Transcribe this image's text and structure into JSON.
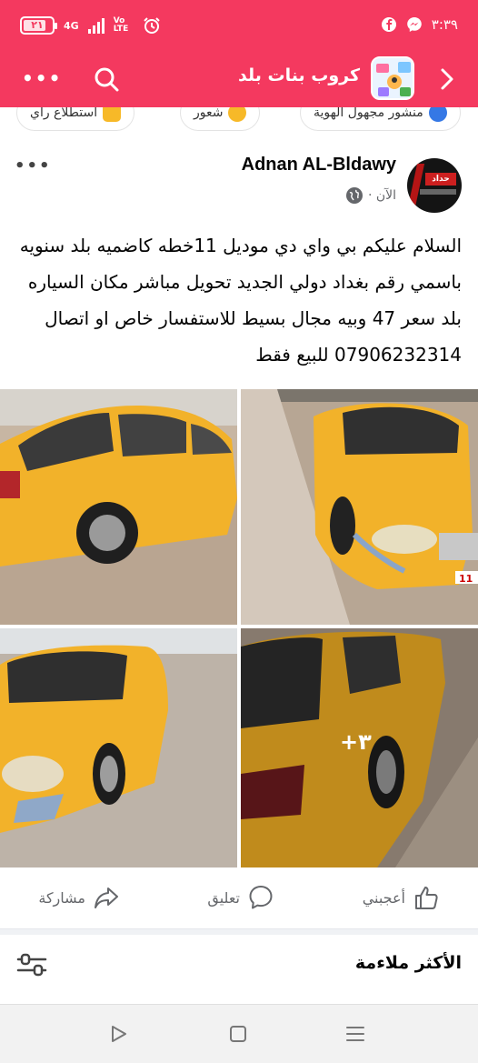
{
  "status_bar": {
    "battery": "٢١",
    "network": "4G",
    "volte": "Vo LTE",
    "time": "٣:٣٩",
    "bg_color": "#f4395f"
  },
  "app_bar": {
    "title": "كروب بنات بلد",
    "icons": [
      "back-chevron-icon",
      "search-icon",
      "more-icon"
    ]
  },
  "chips": [
    {
      "label": "منشور مجهول الهوية",
      "icon": "anonymous-icon"
    },
    {
      "label": "شعور",
      "icon": "feeling-icon"
    },
    {
      "label": "استطلاع رأي",
      "icon": "poll-icon"
    }
  ],
  "post": {
    "author": "Adnan AL-Bldawy",
    "time": "الآن ·",
    "privacy_icon": "globe-icon",
    "avatar_text": "حداد",
    "text": "السلام عليكم بي واي دي موديل 11خطه كاضميه بلد سنويه باسمي رقم بغداد دولي الجديد تحويل مباشر مكان السياره بلد سعر 47 وبيه مجال بسيط للاستفسار خاص او اتصال 07906232314 للبيع فقط",
    "extra_photos": "+٣",
    "plate_text": "11"
  },
  "actions": {
    "like": "أعجبني",
    "comment": "تعليق",
    "share": "مشاركة"
  },
  "sort": {
    "title": "الأكثر ملاءمة"
  },
  "colors": {
    "accent": "#f4395f",
    "taxi_yellow": "#f2b22a",
    "text_secondary": "#65676b"
  }
}
